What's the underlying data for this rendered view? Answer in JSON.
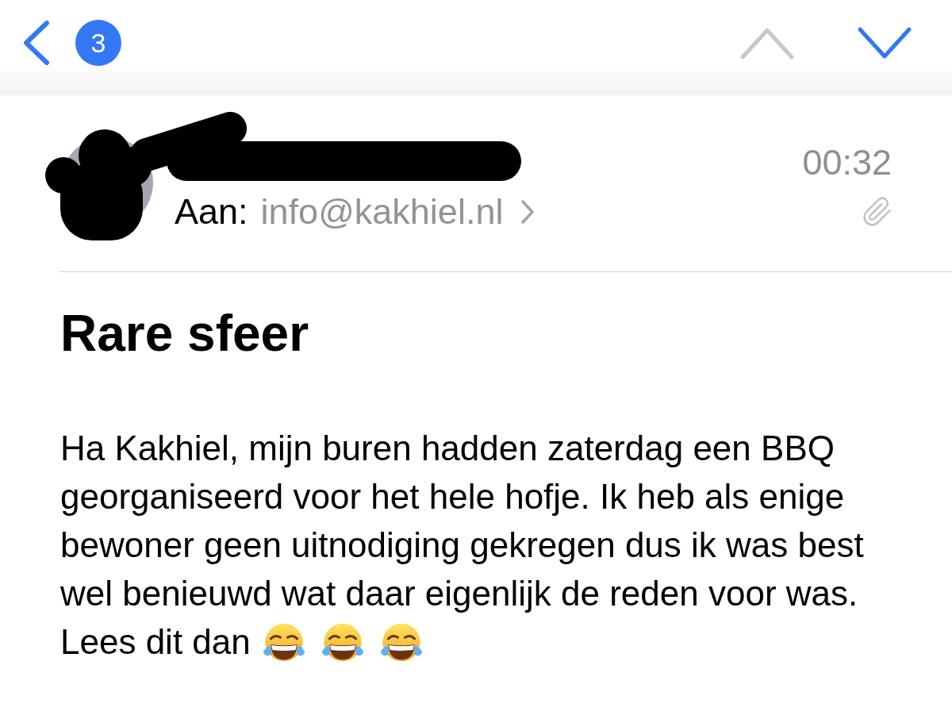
{
  "navigation_bar": {
    "back_button": {
      "badge": "3"
    },
    "previous_button": {
      "disabled": true
    },
    "next_button": {
      "disabled": false
    }
  },
  "message_header": {
    "time": "00:32",
    "recipient_label": "Aan:",
    "recipient": "info@kakhiel.nl",
    "has_attachment": true
  },
  "subject": "Rare sfeer",
  "body": {
    "paragraphs": [
      {
        "text": "Ha Kakhiel, mijn buren hadden zaterdag een BBQ georganiseerd voor het hele hofje. Ik heb als enige bewoner geen uitnodiging gekregen dus ik was best wel benieuwd wat daar eigenlijk de reden voor was."
      },
      {
        "text": "Lees dit dan",
        "emojis": [
          {
            "kind": "tears_of_joy"
          },
          {
            "kind": "tears_of_joy"
          },
          {
            "kind": "tears_of_joy"
          }
        ]
      }
    ]
  }
}
